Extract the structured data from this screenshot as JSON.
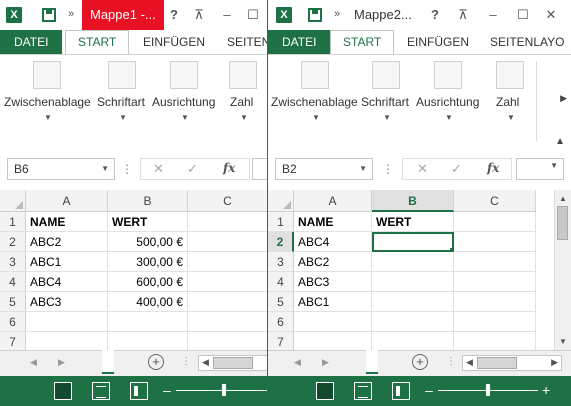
{
  "colors": {
    "accent": "#1e7145",
    "active_title": "#e81123"
  },
  "windows": [
    {
      "title": "Mappe1 -...",
      "tabs": {
        "file": "DATEI",
        "start": "START",
        "insert": "EINFÜGEN",
        "layout": "SEITENL"
      },
      "ribbon": {
        "clipboard": "Zwischenablage",
        "font": "Schriftart",
        "alignment": "Ausrichtung",
        "number": "Zahl"
      },
      "name_box": "B6",
      "columns": [
        "A",
        "B",
        "C"
      ],
      "rows": [
        "1",
        "2",
        "3",
        "4",
        "5",
        "6",
        "7"
      ],
      "cells": [
        [
          "NAME",
          "WERT"
        ],
        [
          "ABC2",
          "500,00 €"
        ],
        [
          "ABC1",
          "300,00 €"
        ],
        [
          "ABC4",
          "600,00 €"
        ],
        [
          "ABC3",
          "400,00 €"
        ],
        [
          "",
          ""
        ],
        [
          "",
          ""
        ]
      ]
    },
    {
      "title": "Mappe2...",
      "tabs": {
        "file": "DATEI",
        "start": "START",
        "insert": "EINFÜGEN",
        "layout": "SEITENLAYO"
      },
      "ribbon": {
        "clipboard": "Zwischenablage",
        "font": "Schriftart",
        "alignment": "Ausrichtung",
        "number": "Zahl"
      },
      "name_box": "B2",
      "columns": [
        "A",
        "B",
        "C"
      ],
      "rows": [
        "1",
        "2",
        "3",
        "4",
        "5",
        "6",
        "7"
      ],
      "cells": [
        [
          "NAME",
          "WERT"
        ],
        [
          "ABC4",
          ""
        ],
        [
          "ABC2",
          ""
        ],
        [
          "ABC3",
          ""
        ],
        [
          "ABC1",
          ""
        ],
        [
          "",
          ""
        ],
        [
          "",
          ""
        ]
      ]
    }
  ],
  "icons": {
    "app": "excel-icon",
    "save": "save-icon",
    "help": "?",
    "restore_ribbon": "ribbon-display-icon",
    "minimize": "–",
    "maximize": "☐",
    "close": "✕",
    "cancel": "✕",
    "enter": "✓",
    "function": "fx",
    "add_sheet": "+"
  }
}
